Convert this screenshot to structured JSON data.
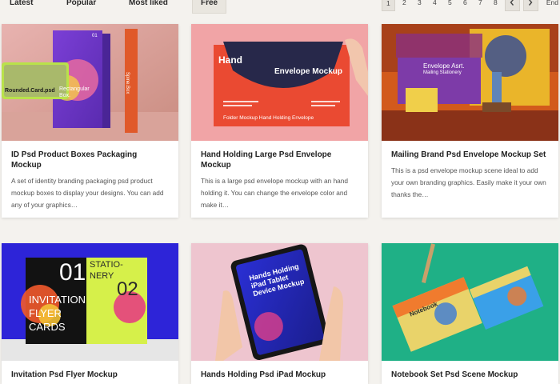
{
  "tabs": [
    {
      "label": "Latest"
    },
    {
      "label": "Popular"
    },
    {
      "label": "Most liked"
    },
    {
      "label": "Free"
    }
  ],
  "pagination": {
    "pages": [
      "1",
      "2",
      "3",
      "4",
      "5",
      "6",
      "7",
      "8"
    ],
    "current": "1",
    "prev_icon": "chevron-left-icon",
    "next_icon": "chevron-right-icon",
    "end_label": "End"
  },
  "cards": [
    {
      "title": "ID Psd Product Boxes Packaging Mockup",
      "description": "A set of identity branding packaging psd product mockup boxes to display your designs. You can add any of your graphics…",
      "thumb": {
        "a": "Rounded.Card.psd",
        "b": "Rectangular Box.",
        "c": "Spine.Box",
        "d": "01"
      }
    },
    {
      "title": "Hand Holding Large Psd Envelope Mockup",
      "description": "This is a large psd envelope mockup with an hand holding it. You can change the envelope color and make it…",
      "thumb": {
        "a": "Hand",
        "b": "Envelope Mockup",
        "c": "Folder Mockup Hand Holding Envelope"
      }
    },
    {
      "title": "Mailing Brand Psd Envelope Mockup Set",
      "description": "This is a psd envelope mockup scene ideal to add your own branding graphics. Easily make it your own thanks the…",
      "thumb": {
        "a": "Envelope Asrt.",
        "b": "Mailing Stationery"
      }
    },
    {
      "title": "Invitation Psd Flyer Mockup",
      "thumb": {
        "a": "01",
        "b": "INVITATION FLYER CARDS",
        "c": "STATIO-NERY",
        "d": "02"
      }
    },
    {
      "title": "Hands Holding Psd iPad Mockup",
      "thumb": {
        "a": "Hands Holding iPad Tablet Device Mockup"
      }
    },
    {
      "title": "Notebook Set Psd Scene Mockup",
      "thumb": {
        "a": "Notebook"
      }
    }
  ],
  "colors": {
    "page_bg": "#f4f2ee",
    "card_bg": "#ffffff",
    "title": "#222222",
    "desc": "#555555"
  }
}
